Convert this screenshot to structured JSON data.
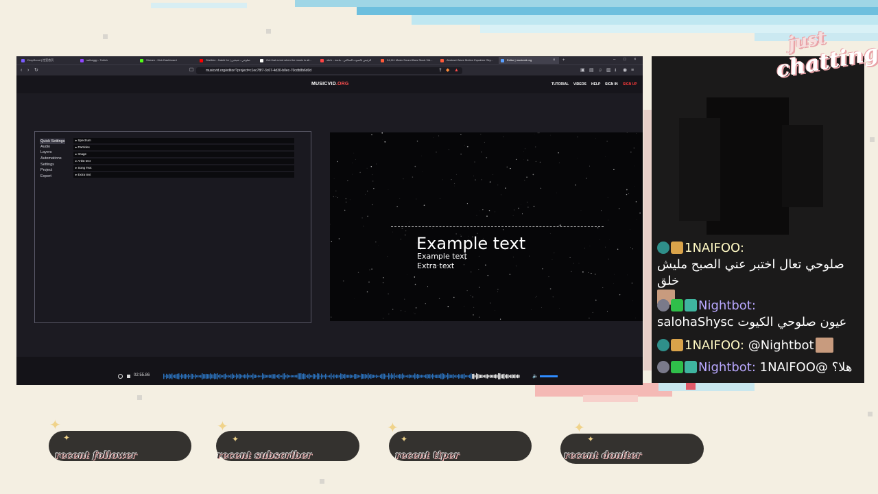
{
  "browser": {
    "tabs": [
      {
        "label": "DropScout | 控室首页",
        "color": "#7a5cff"
      },
      {
        "label": "salhaggy - Twitch",
        "color": "#9146ff"
      },
      {
        "label": "Stream - Kick Dashboard",
        "color": "#53fc18"
      },
      {
        "label": "Sheikhe - Nakhi for | صلوحي - شيخين",
        "color": "#ff0000"
      },
      {
        "label": "Get that event when the music is all...",
        "color": "#ffffff"
      },
      {
        "label": "الرئيس بالصوت الساكني - ماتحة - تاحلة",
        "color": "#ff4444"
      },
      {
        "label": "94,111 Music Sound Bars Stock Vid...",
        "color": "#ff5a3a"
      },
      {
        "label": "Abstract Wave Motion Equalizer Sky...",
        "color": "#ff5a3a"
      },
      {
        "label": "Editor | musicvid.org",
        "color": "#5aa0ff"
      }
    ],
    "url": "musicvid.org/editor/?project=c1ec78f7-3c67-4d30-b0ec-70cdb8b6d0d",
    "tab_close": "×",
    "tab_add": "+"
  },
  "site": {
    "logo_main": "MUSICVID",
    "logo_suffix": ".ORG",
    "nav": [
      "TUTORIAL",
      "VIDEOS",
      "HELP",
      "SIGN IN",
      "SIGN UP"
    ],
    "signup_color": "#ff3b3b"
  },
  "editor": {
    "menu": [
      "Quick Settings",
      "Audio",
      "Layers",
      "Automations",
      "Settings",
      "Project",
      "Export"
    ],
    "layers": [
      "▸ Spectrum",
      "▸ Particles",
      "▸ Image",
      "▸ Artist text",
      "▸ Song Text",
      "▸ Extra text"
    ]
  },
  "preview": {
    "title": "Example text",
    "subtitle": "Example text",
    "extra": "Extra text"
  },
  "timeline": {
    "time": "02:55.86",
    "volume": 0.7
  },
  "chat": {
    "messages": [
      {
        "user": "1NAIFOO:",
        "user_color": "#fff9c4",
        "text": "صلوحي تعال اختبر عني الصبح مليش خلق",
        "badges": [
          "NF",
          "prime"
        ]
      },
      {
        "user": "Nightbot:",
        "user_color": "#b9a8ff",
        "text": "salohaShysc عيون صلوحي الكيوت",
        "badges": [
          "bot",
          "sword",
          "robot"
        ]
      },
      {
        "user": "1NAIFOO:",
        "user_color": "#fff9c4",
        "text": "@Nightbot",
        "badges": [
          "NF",
          "prime"
        ]
      },
      {
        "user": "Nightbot:",
        "user_color": "#b9a8ff",
        "text": "1NAIFOO@ هلا؟",
        "badges": [
          "bot",
          "sword",
          "robot"
        ]
      }
    ]
  },
  "overlay": {
    "title_line1": "just",
    "title_line2": "chatting",
    "pills": [
      "recent follower",
      "recent subscriber",
      "recent tiper",
      "recent doniter"
    ]
  }
}
